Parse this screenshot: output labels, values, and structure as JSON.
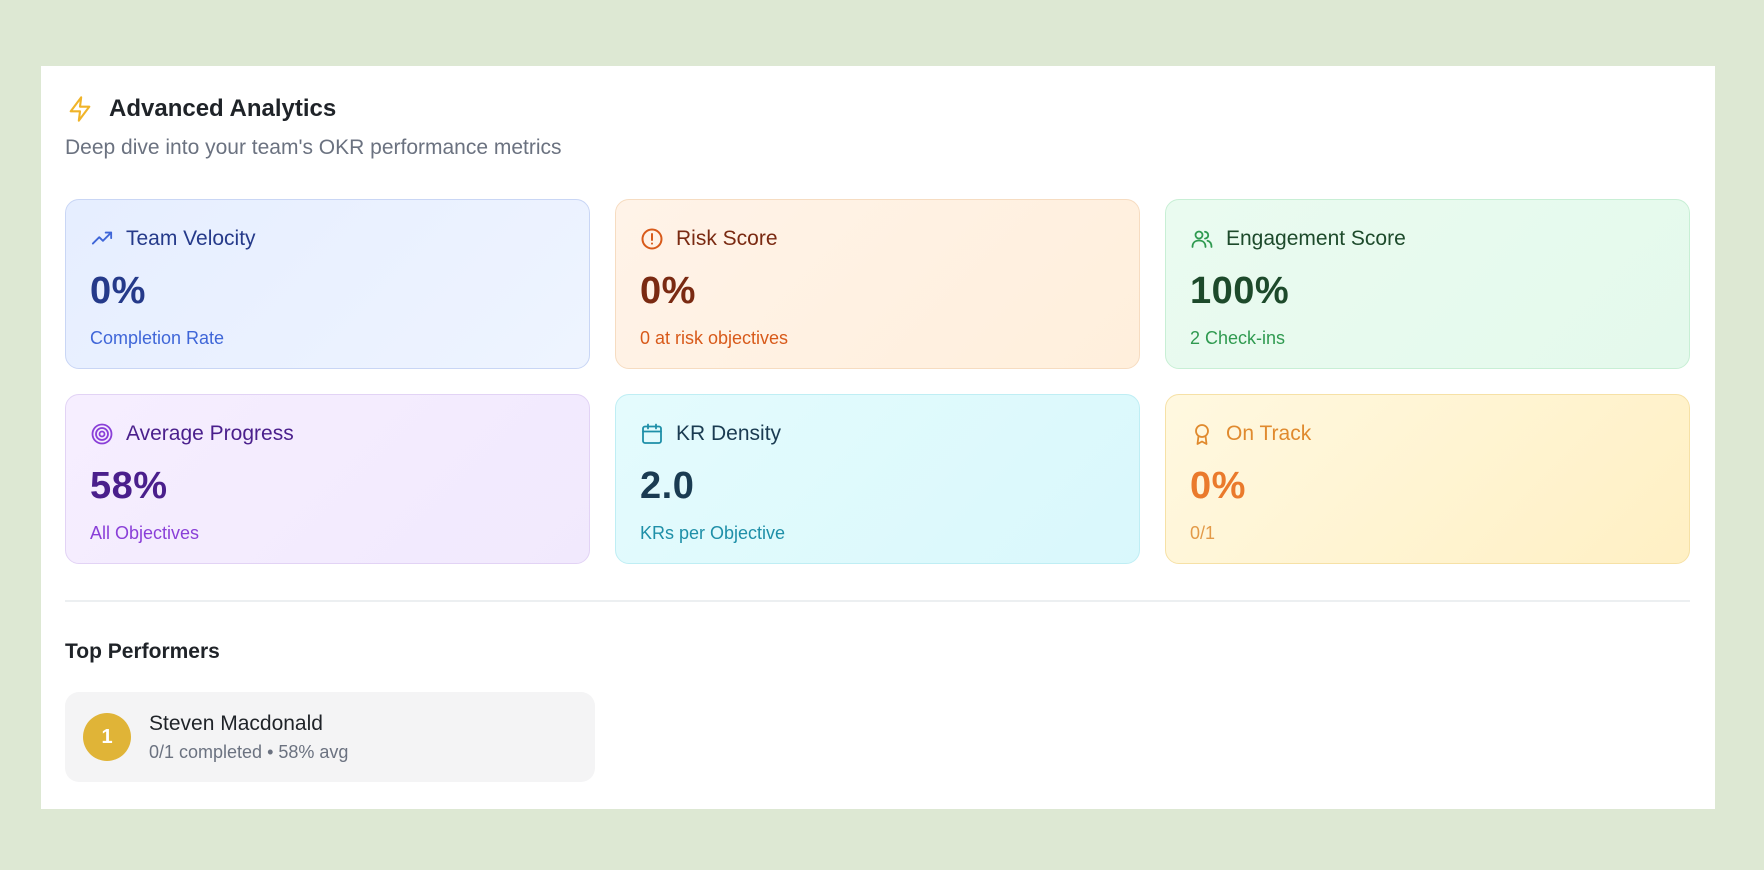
{
  "header": {
    "title": "Advanced Analytics",
    "subtitle": "Deep dive into your team's OKR performance metrics",
    "icon": "lightning-icon",
    "icon_color": "#f0b429"
  },
  "cards": [
    {
      "icon": "trending-up-icon",
      "label": "Team Velocity",
      "value": "0%",
      "sub": "Completion Rate",
      "accent": "#3f66d8"
    },
    {
      "icon": "alert-circle-icon",
      "label": "Risk Score",
      "value": "0%",
      "sub": "0 at risk objectives",
      "accent": "#d85a1a"
    },
    {
      "icon": "users-icon",
      "label": "Engagement Score",
      "value": "100%",
      "sub": "2 Check-ins",
      "accent": "#2f9a50"
    },
    {
      "icon": "target-icon",
      "label": "Average Progress",
      "value": "58%",
      "sub": "All Objectives",
      "accent": "#8a3fd8"
    },
    {
      "icon": "calendar-icon",
      "label": "KR Density",
      "value": "2.0",
      "sub": "KRs per Objective",
      "accent": "#1e8fa8"
    },
    {
      "icon": "award-icon",
      "label": "On Track",
      "value": "0%",
      "sub": "0/1",
      "accent": "#e39a48"
    }
  ],
  "top_performers": {
    "title": "Top Performers",
    "items": [
      {
        "rank": "1",
        "name": "Steven Macdonald",
        "meta": "0/1 completed • 58% avg",
        "rank_color": "#e0b437"
      }
    ]
  }
}
